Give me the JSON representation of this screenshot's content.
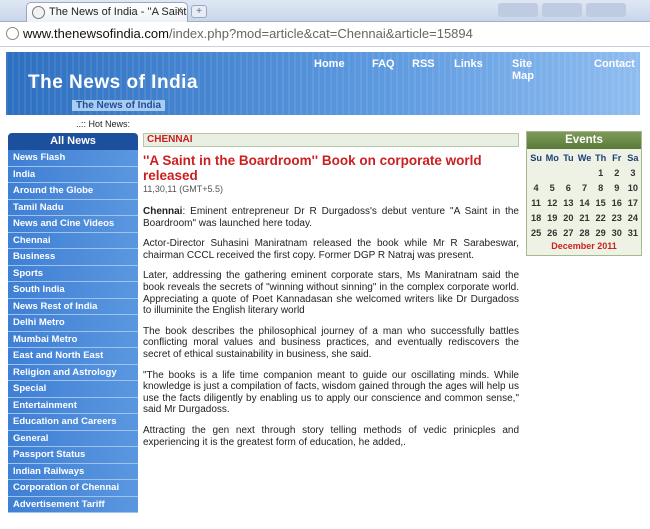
{
  "browser": {
    "tab_title": "The News of India - ''A Saint",
    "tab_close": "x",
    "new_tab": "+",
    "address_domain": "www.thenewsofindia.com",
    "address_path": "/index.php?mod=article&cat=Chennai&article=15894"
  },
  "header": {
    "site_title": "The News of India",
    "site_subtitle": "The News of India",
    "nav": [
      "Home",
      "FAQ",
      "RSS",
      "Links",
      "Site Map",
      "Contact"
    ],
    "hot_news_label": "..:: Hot News:"
  },
  "sidebar": {
    "heading": "All News",
    "items": [
      "News Flash",
      "India",
      "Around the Globe",
      "Tamil Nadu",
      "News and Cine Videos",
      "Chennai",
      "Business",
      "Sports",
      "South India",
      "News Rest of India",
      "Delhi Metro",
      "Mumbai Metro",
      "East and North East",
      "Religion and Astrology",
      "Special",
      "Entertainment",
      "Education and Careers",
      "General",
      "Passport Status",
      "Indian Railways",
      "Corporation of Chennai",
      "Advertisement Tariff"
    ]
  },
  "article": {
    "category": "CHENNAI",
    "headline": "''A Saint in the Boardroom'' Book on corporate world released",
    "date": "11,30,11 (GMT+5.5)",
    "p1_lead": "Chennai",
    "p1_rest": ": Eminent entrepreneur Dr R Durgadoss's debut venture  \"A Saint in the Boardroom\" was launched here today.",
    "p2": "Actor-Director Suhasini Maniratnam released the book while Mr R Sarabeswar, chairman CCCL received the first copy. Former DGP R Natraj was present.",
    "p3": "Later, addressing the gathering eminent corporate stars, Ms Maniratnam said the book reveals the secrets of \"winning without sinning\" in the complex corporate world.  Appreciating a quote of Poet Kannadasan she welcomed writers like Dr Durgadoss to illuminite the English literary world",
    "p4": "The book describes the philosophical journey of a man who successfully battles conflicting moral values and business practices, and eventually rediscovers the secret of ethical sustainability in business, she said.",
    "p5": "\"The books is a life time companion meant to guide our oscillating minds. While knowledge is just a compilation of facts, wisdom gained through the ages will help us use the facts diligently by enabling us to apply our conscience and common sense,\" said Mr Durgadoss.",
    "p6": "Attracting the gen next through story telling methods of vedic prinicples and experiencing it is the greatest form of education, he added,."
  },
  "events": {
    "heading": "Events",
    "weekdays": [
      "Su",
      "Mo",
      "Tu",
      "We",
      "Th",
      "Fr",
      "Sa"
    ],
    "weeks": [
      [
        "",
        "",
        "",
        "",
        "1",
        "2",
        "3"
      ],
      [
        "4",
        "5",
        "6",
        "7",
        "8",
        "9",
        "10"
      ],
      [
        "11",
        "12",
        "13",
        "14",
        "15",
        "16",
        "17"
      ],
      [
        "18",
        "19",
        "20",
        "21",
        "22",
        "23",
        "24"
      ],
      [
        "25",
        "26",
        "27",
        "28",
        "29",
        "30",
        "31"
      ]
    ],
    "month_label": "December 2011"
  },
  "colors": {
    "banner_blue": "#2d6fc0",
    "sidebar_blue": "#3f7fd4",
    "headline_red": "#cc1f1f",
    "events_green": "#5b7a3a"
  }
}
